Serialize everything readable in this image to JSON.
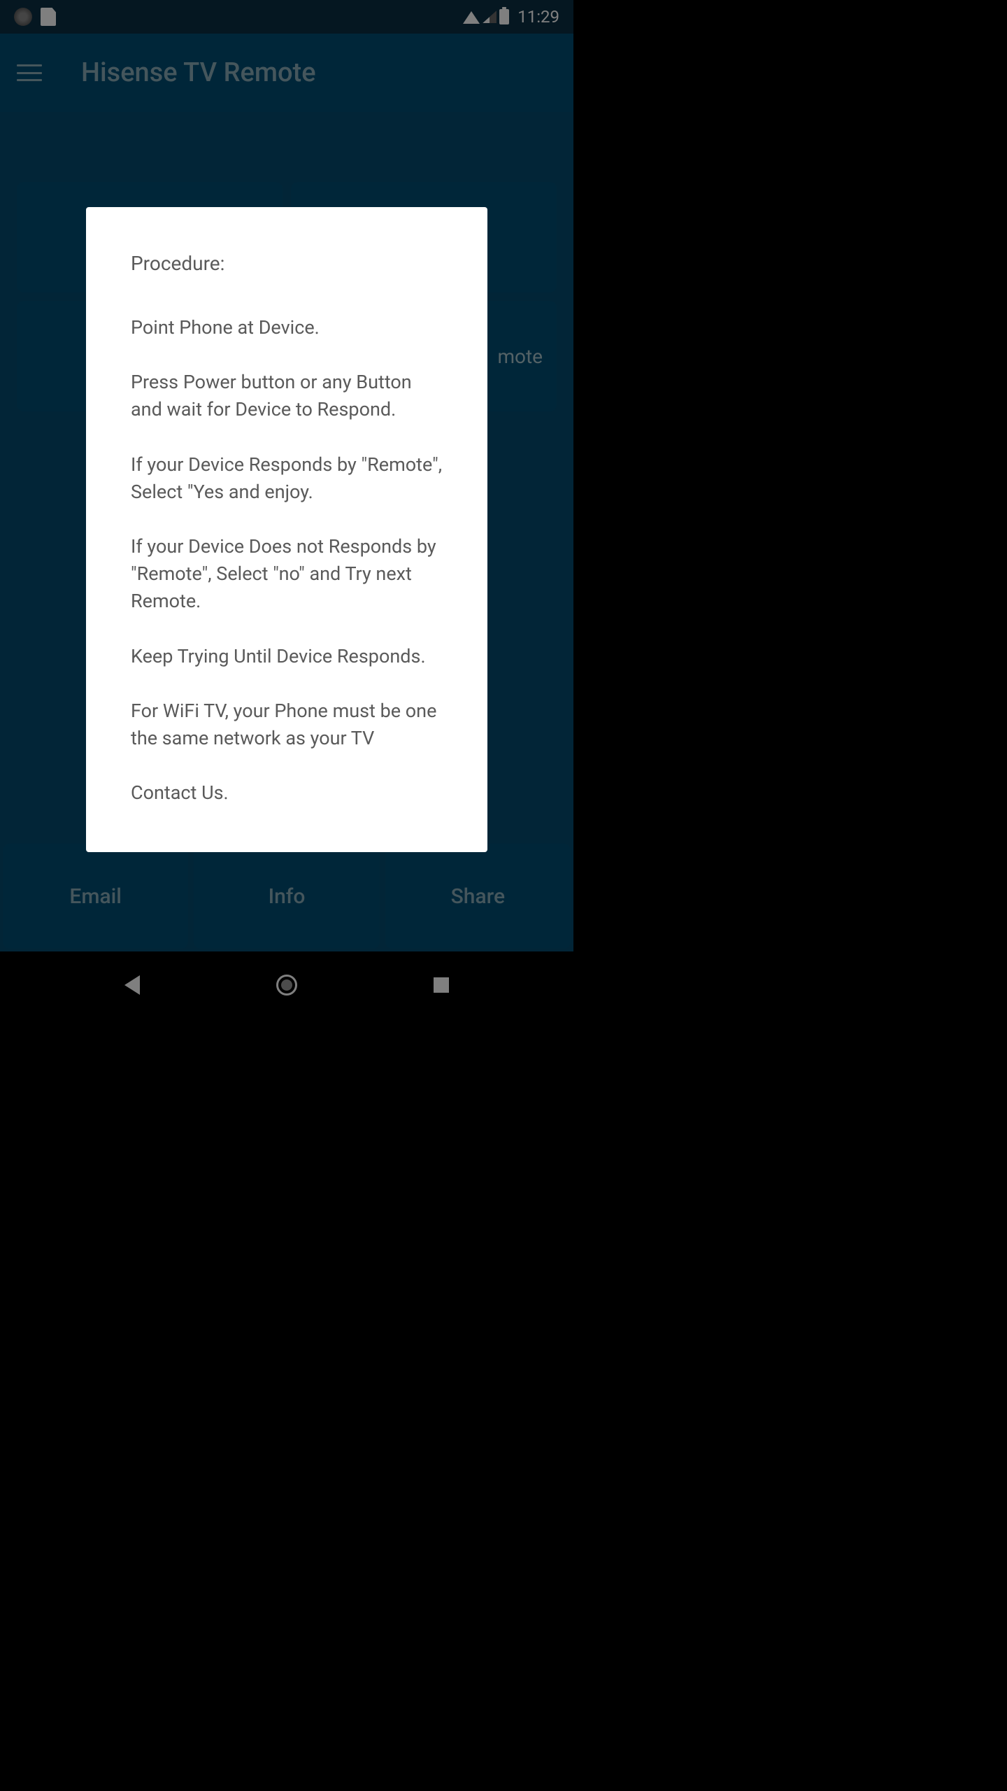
{
  "statusBar": {
    "time": "11:29"
  },
  "appBar": {
    "title": "Hisense TV Remote"
  },
  "buttons": {
    "remote": "mote"
  },
  "bottomBar": {
    "email": "Email",
    "info": "Info",
    "share": "Share"
  },
  "dialog": {
    "title": "Procedure:",
    "body": "Point Phone at Device.\n\nPress Power button or any Button and wait for Device to Respond.\n\nIf your Device Responds by \"Remote\", Select \"Yes and enjoy.\n\nIf your Device Does not Responds by \"Remote\", Select \"no\" and Try next Remote.\n\nKeep Trying Until Device Responds.\n\nFor WiFi TV, your Phone must be one the same network as your TV\n\nContact Us."
  }
}
